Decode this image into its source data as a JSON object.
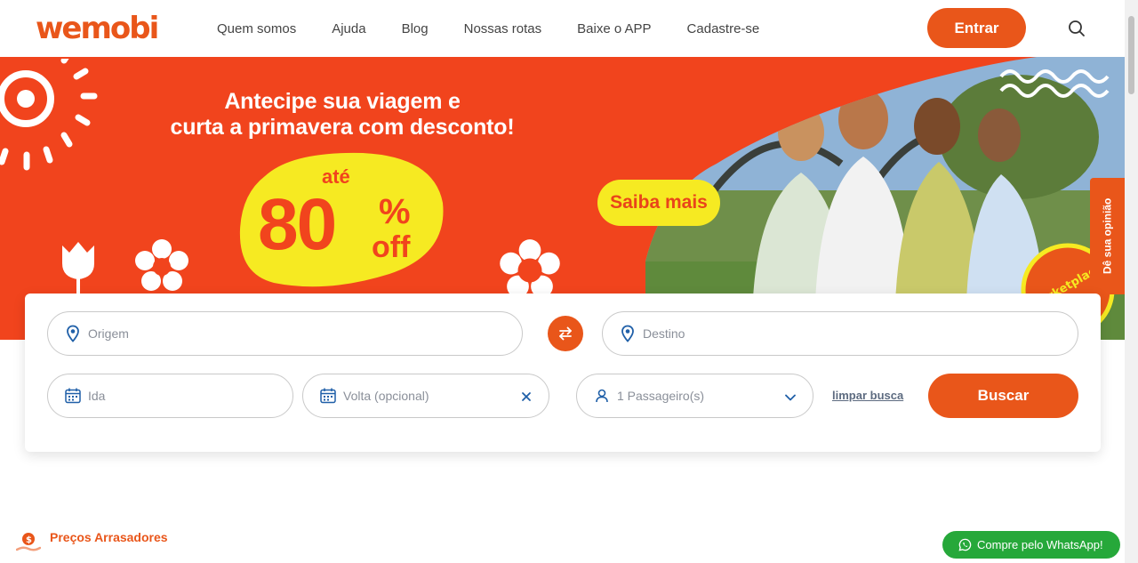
{
  "brand": {
    "logo_text": "wemobi",
    "accent": "#e9561a"
  },
  "nav": {
    "items": [
      "Quem somos",
      "Ajuda",
      "Blog",
      "Nossas rotas",
      "Baixe o APP",
      "Cadastre-se"
    ],
    "login_label": "Entrar",
    "search_icon": "search-icon"
  },
  "banner": {
    "headline_line1": "Antecipe sua viagem e",
    "headline_line2": "curta a primavera com desconto!",
    "promo_prefix": "até",
    "promo_number": "80",
    "promo_percent": "%",
    "promo_suffix": "off",
    "cta_label": "Saiba mais",
    "badge_text": "marketplace"
  },
  "feedback_tab": {
    "label": "Dê sua opinião"
  },
  "search": {
    "origin_placeholder": "Origem",
    "destination_placeholder": "Destino",
    "departure_placeholder": "Ida",
    "return_placeholder": "Volta (opcional)",
    "passengers_value": "1 Passageiro(s)",
    "clear_label": "limpar busca",
    "submit_label": "Buscar"
  },
  "sections": {
    "first_title": "Preços Arrasadores"
  },
  "whatsapp": {
    "label": "Compre pelo WhatsApp!"
  }
}
